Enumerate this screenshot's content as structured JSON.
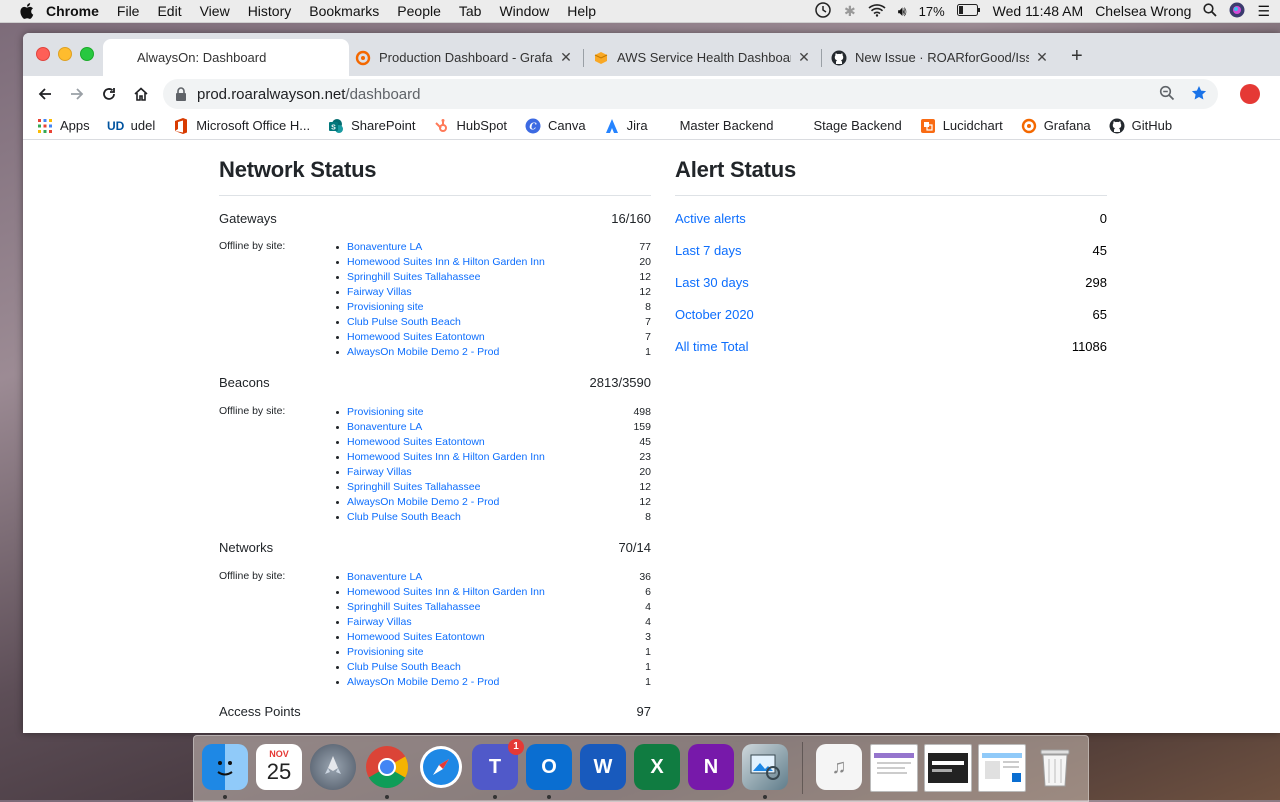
{
  "menubar": {
    "app_name": "Chrome",
    "menus": [
      "File",
      "Edit",
      "View",
      "History",
      "Bookmarks",
      "People",
      "Tab",
      "Window",
      "Help"
    ],
    "battery": "17%",
    "clock": "Wed 11:48 AM",
    "user": "Chelsea Wrong"
  },
  "tabs": [
    {
      "title": "AlwaysOn: Dashboard"
    },
    {
      "title": "Production Dashboard - Grafana"
    },
    {
      "title": "AWS Service Health Dashboard"
    },
    {
      "title": "New Issue · ROARforGood/Issues"
    }
  ],
  "address": {
    "host": "prod.roaralwayson.net",
    "path": "/dashboard"
  },
  "bookmarks": [
    "Apps",
    "udel",
    "Microsoft Office H...",
    "SharePoint",
    "HubSpot",
    "Canva",
    "Jira",
    "Master Backend",
    "Stage Backend",
    "Lucidchart",
    "Grafana",
    "GitHub"
  ],
  "network": {
    "title": "Network Status",
    "offline_label": "Offline by site:",
    "sections": [
      {
        "label": "Gateways",
        "value": "16/160",
        "sites": [
          {
            "name": "Bonaventure LA",
            "count": "77"
          },
          {
            "name": "Homewood Suites Inn & Hilton Garden Inn",
            "count": "20"
          },
          {
            "name": "Springhill Suites Tallahassee",
            "count": "12"
          },
          {
            "name": "Fairway Villas",
            "count": "12"
          },
          {
            "name": "Provisioning site",
            "count": "8"
          },
          {
            "name": "Club Pulse South Beach",
            "count": "7"
          },
          {
            "name": "Homewood Suites Eatontown",
            "count": "7"
          },
          {
            "name": "AlwaysOn Mobile Demo 2 - Prod",
            "count": "1"
          }
        ]
      },
      {
        "label": "Beacons",
        "value": "2813/3590",
        "sites": [
          {
            "name": "Provisioning site",
            "count": "498"
          },
          {
            "name": "Bonaventure LA",
            "count": "159"
          },
          {
            "name": "Homewood Suites Eatontown",
            "count": "45"
          },
          {
            "name": "Homewood Suites Inn & Hilton Garden Inn",
            "count": "23"
          },
          {
            "name": "Fairway Villas",
            "count": "20"
          },
          {
            "name": "Springhill Suites Tallahassee",
            "count": "12"
          },
          {
            "name": "AlwaysOn Mobile Demo 2 - Prod",
            "count": "12"
          },
          {
            "name": "Club Pulse South Beach",
            "count": "8"
          }
        ]
      },
      {
        "label": "Networks",
        "value": "70/14",
        "sites": [
          {
            "name": "Bonaventure LA",
            "count": "36"
          },
          {
            "name": "Homewood Suites Inn & Hilton Garden Inn",
            "count": "6"
          },
          {
            "name": "Springhill Suites Tallahassee",
            "count": "4"
          },
          {
            "name": "Fairway Villas",
            "count": "4"
          },
          {
            "name": "Homewood Suites Eatontown",
            "count": "3"
          },
          {
            "name": "Provisioning site",
            "count": "1"
          },
          {
            "name": "Club Pulse South Beach",
            "count": "1"
          },
          {
            "name": "AlwaysOn Mobile Demo 2 - Prod",
            "count": "1"
          }
        ]
      },
      {
        "label": "Access Points",
        "value": "97",
        "sites": []
      }
    ]
  },
  "alerts": {
    "title": "Alert Status",
    "rows": [
      {
        "label": "Active alerts",
        "value": "0"
      },
      {
        "label": "Last 7 days",
        "value": "45"
      },
      {
        "label": "Last 30 days",
        "value": "298"
      },
      {
        "label": "October 2020",
        "value": "65"
      },
      {
        "label": "All time Total",
        "value": "11086"
      }
    ]
  },
  "dock": {
    "calendar_month": "NOV",
    "calendar_day": "25",
    "teams_badge": "1",
    "items": [
      "finder-icon",
      "calendar-icon",
      "launchpad-icon",
      "chrome-icon",
      "safari-icon",
      "teams-icon",
      "outlook-icon",
      "word-icon",
      "excel-icon",
      "onenote-icon",
      "preview-icon",
      "music-icon",
      "window-thumbnail-icon",
      "window-thumbnail-icon",
      "window-thumbnail-icon",
      "trash-icon"
    ]
  },
  "colors": {
    "link": "#0d6efd",
    "text": "#212529",
    "rule": "#dee2e6"
  }
}
